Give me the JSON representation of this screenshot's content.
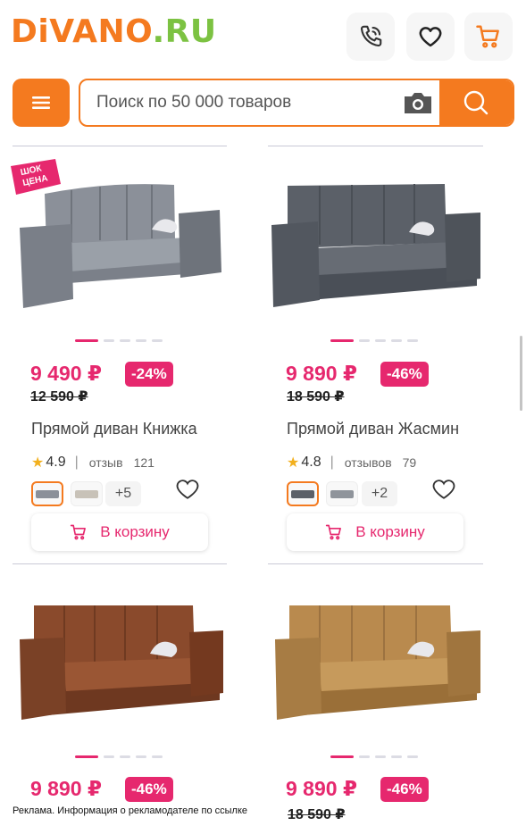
{
  "header": {
    "logo_brand": "DiVANO",
    "logo_domain": ".RU",
    "search_placeholder": "Поиск по 50 000 товаров"
  },
  "products": [
    {
      "promo": "ШОК ЦЕНА",
      "price": "9 490 ₽",
      "discount": "-24%",
      "old_price": "12 590 ₽",
      "title": "Прямой диван Книжка",
      "rating": "4.9",
      "review_word": "отзыв",
      "review_count": "121",
      "more_colors": "+5",
      "cart_label": "В корзину",
      "color": "#8b9099"
    },
    {
      "price": "9 890 ₽",
      "discount": "-46%",
      "old_price": "18 590 ₽",
      "title": "Прямой диван Жасмин",
      "rating": "4.8",
      "review_word": "отзывов",
      "review_count": "79",
      "more_colors": "+2",
      "cart_label": "В корзину",
      "color": "#5b6068"
    },
    {
      "price": "9 890 ₽",
      "discount": "-46%",
      "color": "#8a4a2c"
    },
    {
      "price": "9 890 ₽",
      "discount": "-46%",
      "old_price": "18 590 ₽",
      "color": "#b98a4e"
    }
  ],
  "ad_notice": "Реклама. Информация о рекламодателе по ссылке",
  "colors": {
    "orange": "#f47a1f",
    "pink": "#e6286e",
    "green": "#7cc242"
  }
}
